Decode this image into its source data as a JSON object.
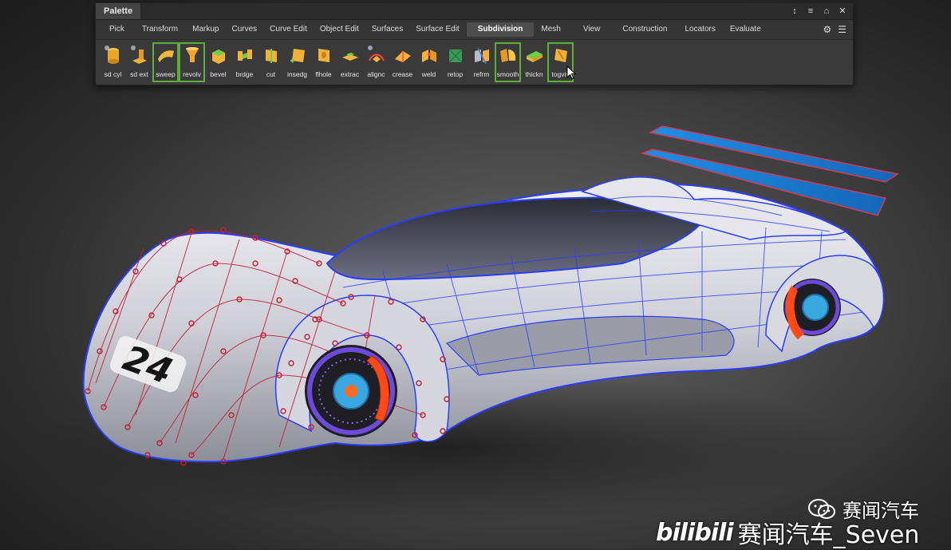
{
  "palette": {
    "title": "Palette",
    "window_controls": [
      "↕",
      "≡",
      "⌂",
      "✕"
    ],
    "tabs": [
      {
        "label": "Pick",
        "active": false
      },
      {
        "label": "Transform",
        "active": false
      },
      {
        "label": "Markup",
        "active": false
      },
      {
        "label": "Curves",
        "active": false
      },
      {
        "label": "Curve Edit",
        "active": false
      },
      {
        "label": "Object Edit",
        "active": false
      },
      {
        "label": "Surfaces",
        "active": false
      },
      {
        "label": "Surface Edit",
        "active": false
      },
      {
        "label": "Subdivision",
        "active": true
      },
      {
        "label": "Mesh",
        "active": false
      },
      {
        "label": "View",
        "active": false
      },
      {
        "label": "Construction",
        "active": false
      },
      {
        "label": "Locators",
        "active": false
      },
      {
        "label": "Evaluate",
        "active": false
      }
    ],
    "tab_tools": {
      "gear_icon": "⚙",
      "menu_icon": "☰"
    },
    "tools": [
      {
        "label": "sd cyl",
        "icon": "cylinder-icon",
        "selected": false
      },
      {
        "label": "sd ext",
        "icon": "extrude-icon",
        "selected": false
      },
      {
        "label": "sweep",
        "icon": "sweep-icon",
        "selected": true
      },
      {
        "label": "revolv",
        "icon": "revolve-icon",
        "selected": true
      },
      {
        "label": "bevel",
        "icon": "bevel-icon",
        "selected": false
      },
      {
        "label": "brdge",
        "icon": "bridge-icon",
        "selected": false
      },
      {
        "label": "cut",
        "icon": "cut-icon",
        "selected": false
      },
      {
        "label": "insedg",
        "icon": "insert-edge-icon",
        "selected": false
      },
      {
        "label": "flhole",
        "icon": "fill-hole-icon",
        "selected": false
      },
      {
        "label": "extrac",
        "icon": "extract-icon",
        "selected": false
      },
      {
        "label": "alignc",
        "icon": "align-curve-icon",
        "selected": false
      },
      {
        "label": "crease",
        "icon": "crease-icon",
        "selected": false
      },
      {
        "label": "weld",
        "icon": "weld-icon",
        "selected": false
      },
      {
        "label": "retop",
        "icon": "retopo-icon",
        "selected": false
      },
      {
        "label": "refrm",
        "icon": "reform-icon",
        "selected": false
      },
      {
        "label": "smooth",
        "icon": "smooth-icon",
        "selected": true
      },
      {
        "label": "thickn",
        "icon": "thicken-icon",
        "selected": false
      },
      {
        "label": "togvis",
        "icon": "toggle-visibility-icon",
        "selected": true
      }
    ]
  },
  "viewport": {
    "car_number": "24"
  },
  "watermarks": {
    "wechat_text": "赛闻汽车",
    "bilibili_logo": "bilibili",
    "bilibili_text": "赛闻汽车_Seven"
  },
  "colors": {
    "accent_select": "#5fae3c",
    "wire_blue": "#2a3cff",
    "cv_red": "#d0223a",
    "caliper_orange": "#ff4a16"
  }
}
